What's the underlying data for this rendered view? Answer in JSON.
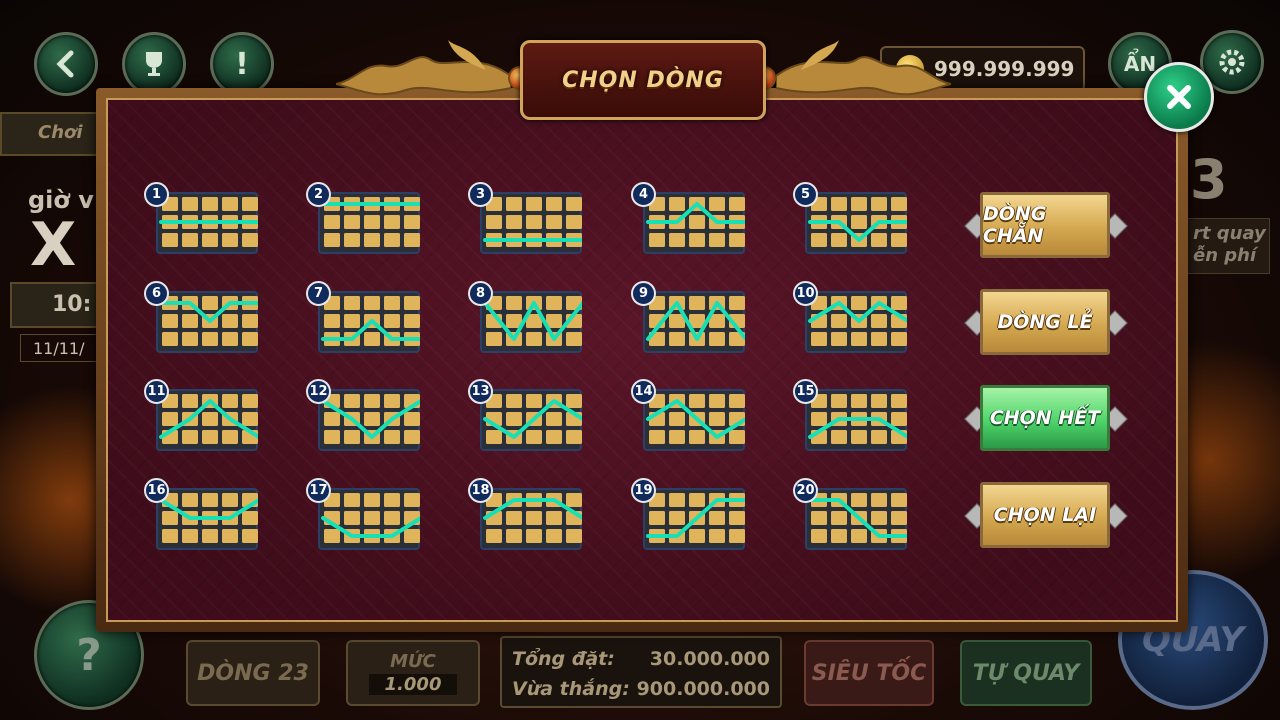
{
  "background": {
    "coins": "999.999.999",
    "hide_label": "ẨN",
    "play_tab": "Chơi",
    "time_label": "giờ v",
    "multiplier": "X",
    "timer": "10:",
    "date": "11/11/",
    "free_spins_count": "3",
    "free_spins_line1": "rt quay",
    "free_spins_line2": "ễn phí",
    "lines_button": "DÒNG 23",
    "level_label": "MỨC",
    "level_value": "1.000",
    "total_bet_label": "Tổng đặt:",
    "total_bet_value": "30.000.000",
    "just_won_label": "Vừa thắng:",
    "just_won_value": "900.000.000",
    "turbo_button": "SIÊU TỐC",
    "auto_button": "TỰ QUAY",
    "spin_button": "QUAY",
    "help_button": "?"
  },
  "modal": {
    "title": "CHỌN DÒNG",
    "lines": [
      {
        "label": "1",
        "path": [
          1,
          1,
          1,
          1,
          1
        ]
      },
      {
        "label": "2",
        "path": [
          0,
          0,
          0,
          0,
          0
        ]
      },
      {
        "label": "3",
        "path": [
          2,
          2,
          2,
          2,
          2
        ]
      },
      {
        "label": "4",
        "path": [
          1,
          1,
          0,
          1,
          1
        ]
      },
      {
        "label": "5",
        "path": [
          1,
          1,
          2,
          1,
          1
        ]
      },
      {
        "label": "6",
        "path": [
          0,
          0,
          1,
          0,
          0
        ]
      },
      {
        "label": "7",
        "path": [
          2,
          2,
          1,
          2,
          2
        ]
      },
      {
        "label": "8",
        "path": [
          0,
          2,
          0,
          2,
          0
        ]
      },
      {
        "label": "9",
        "path": [
          2,
          0,
          2,
          0,
          2
        ]
      },
      {
        "label": "10",
        "path": [
          1,
          0,
          1,
          0,
          1
        ]
      },
      {
        "label": "11",
        "path": [
          2,
          1,
          0,
          1,
          2
        ]
      },
      {
        "label": "12",
        "path": [
          0,
          1,
          2,
          1,
          0
        ]
      },
      {
        "label": "13",
        "path": [
          1,
          2,
          1,
          0,
          1
        ]
      },
      {
        "label": "14",
        "path": [
          1,
          0,
          1,
          2,
          1
        ]
      },
      {
        "label": "15",
        "path": [
          2,
          1,
          1,
          1,
          2
        ]
      },
      {
        "label": "16",
        "path": [
          0,
          1,
          1,
          1,
          0
        ]
      },
      {
        "label": "17",
        "path": [
          1,
          2,
          2,
          2,
          1
        ]
      },
      {
        "label": "18",
        "path": [
          1,
          0,
          0,
          0,
          1
        ]
      },
      {
        "label": "19",
        "path": [
          2,
          2,
          1,
          0,
          0
        ]
      },
      {
        "label": "20",
        "path": [
          0,
          0,
          1,
          2,
          2
        ]
      }
    ],
    "options": {
      "even": "DÒNG CHẴN",
      "odd": "DÒNG LẺ",
      "all": "CHỌN HẾT",
      "reset": "CHỌN LẠI"
    }
  },
  "colors": {
    "line": "#19e0b4",
    "cell": "#e0b45a",
    "modal_bg": "#4a1020",
    "gold": "#d4a850",
    "active_green": "#4fd46a"
  },
  "icons": [
    "back-arrow-icon",
    "trophy-icon",
    "info-icon",
    "coin-icon",
    "settings-gear-icon",
    "close-icon"
  ]
}
